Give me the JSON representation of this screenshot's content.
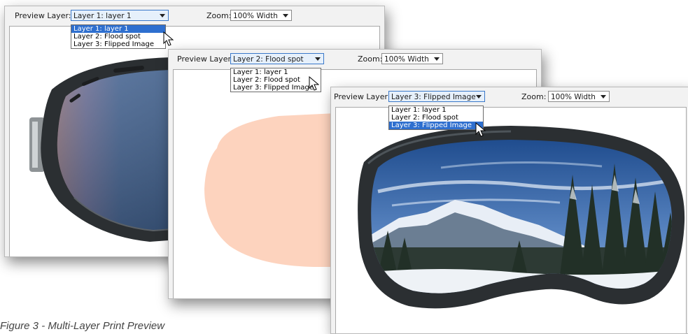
{
  "windows": [
    {
      "preview_label": "Preview Layer:",
      "selected": "Layer 1: layer 1",
      "zoom_label": "Zoom:",
      "zoom_value": "100% Width",
      "options": [
        "Layer 1: layer 1",
        "Layer 2: Flood spot",
        "Layer 3: Flipped Image"
      ],
      "highlighted_index": 0
    },
    {
      "preview_label": "Preview Layer:",
      "selected": "Layer 2: Flood spot",
      "zoom_label": "Zoom:",
      "zoom_value": "100% Width",
      "options": [
        "Layer 1: layer 1",
        "Layer 2: Flood spot",
        "Layer 3: Flipped Image"
      ],
      "highlighted_index": -1
    },
    {
      "preview_label": "Preview Layer:",
      "selected": "Layer 3: Flipped Image",
      "zoom_label": "Zoom:",
      "zoom_value": "100% Width",
      "options": [
        "Layer 1: layer 1",
        "Layer 2: Flood spot",
        "Layer 3: Flipped Image"
      ],
      "highlighted_index": 2
    }
  ],
  "caption": "Figure 3 - Multi-Layer Print Preview",
  "colors": {
    "flood_spot": "#fdd3be",
    "highlight": "#2e6fcf",
    "goggle_frame": "#2b2f32"
  },
  "icons": [
    "dropdown-arrow-icon",
    "mouse-pointer-icon"
  ]
}
